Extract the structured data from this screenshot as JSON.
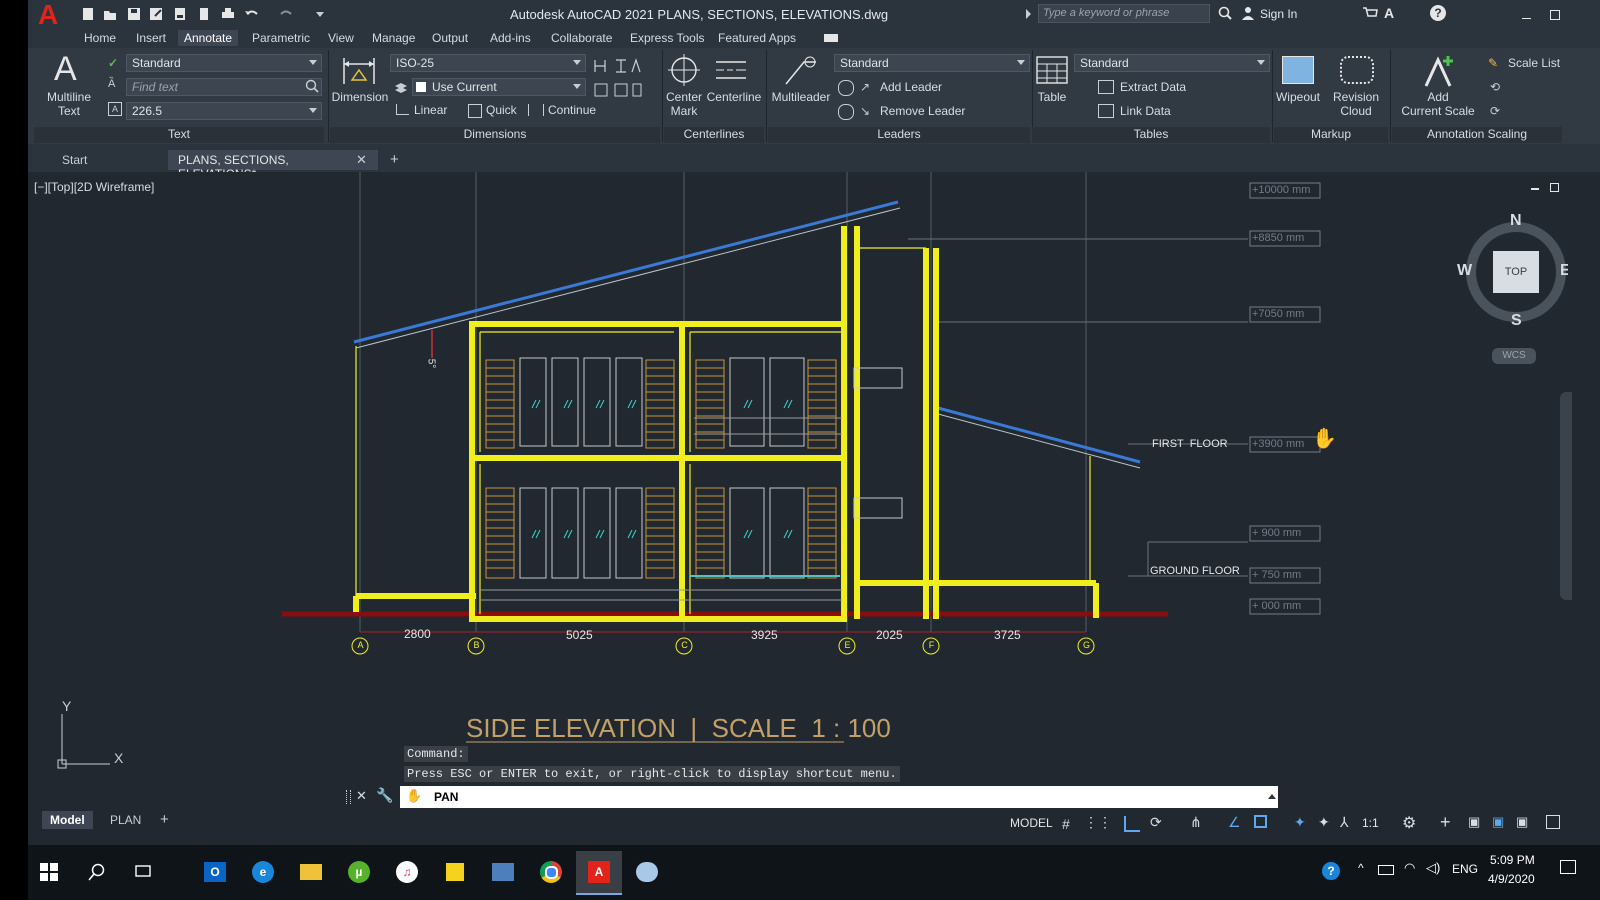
{
  "quick_access": {
    "icons": [
      "new-icon",
      "open-icon",
      "save-icon",
      "save-as-icon",
      "plot-icon",
      "publish-icon",
      "print-icon",
      "undo-icon",
      "redo-icon",
      "dropdown-icon"
    ]
  },
  "window": {
    "title": "Autodesk AutoCAD 2021    PLANS, SECTIONS, ELEVATIONS.dwg",
    "search_placeholder": "Type a keyword or phrase",
    "sign_in": "Sign In"
  },
  "menu_tabs": [
    "Home",
    "Insert",
    "Annotate",
    "Parametric",
    "View",
    "Manage",
    "Output",
    "Add-ins",
    "Collaborate",
    "Express Tools",
    "Featured Apps"
  ],
  "active_tab": "Annotate",
  "ribbon": {
    "text_panel": {
      "title": "Text",
      "big_button": "Multiline\nText",
      "style": "Standard",
      "find_placeholder": "Find text",
      "height": "226.5"
    },
    "dimensions_panel": {
      "title": "Dimensions",
      "big_button": "Dimension",
      "style": "ISO-25",
      "layer": "Use Current",
      "linear": "Linear",
      "quick": "Quick",
      "continue": "Continue"
    },
    "centerlines_panel": {
      "title": "Centerlines",
      "center_mark": "Center\nMark",
      "centerline": "Centerline"
    },
    "leaders_panel": {
      "title": "Leaders",
      "big_button": "Multileader",
      "style": "Standard",
      "add_leader": "Add Leader",
      "remove_leader": "Remove Leader"
    },
    "tables_panel": {
      "title": "Tables",
      "big_button": "Table",
      "style": "Standard",
      "extract": "Extract Data",
      "link": "Link Data"
    },
    "markup_panel": {
      "title": "Markup",
      "wipeout": "Wipeout",
      "revision": "Revision\nCloud"
    },
    "scaling_panel": {
      "title": "Annotation Scaling",
      "add_scale": "Add\nCurrent Scale",
      "scale_list": "Scale List"
    }
  },
  "file_tabs": {
    "start": "Start",
    "active": "PLANS, SECTIONS, ELEVATIONS*"
  },
  "viewport": {
    "label": "[−][Top][2D Wireframe]",
    "viewcube": {
      "n": "N",
      "s": "S",
      "w": "W",
      "e": "E",
      "top": "TOP",
      "wcs": "WCS"
    },
    "levels": [
      "+10000 mm",
      "+8850 mm",
      "+7050 mm",
      "+3900 mm",
      "+ 900 mm",
      "+ 750 mm",
      "+ 000 mm"
    ],
    "floor_labels": {
      "first": "FIRST  FLOOR",
      "ground": "GROUND FLOOR"
    },
    "grid_letters": [
      "A",
      "B",
      "C",
      "E",
      "F",
      "G"
    ],
    "grid_dims": [
      "2800",
      "5025",
      "3925",
      "2025",
      "3725"
    ],
    "slope_label": "5°",
    "drawing_title": "SIDE ELEVATION  |  SCALE  1 : 100",
    "ucs": {
      "x": "X",
      "y": "Y"
    }
  },
  "command": {
    "history": [
      "Command:",
      "Press ESC or ENTER to exit, or right-click to display shortcut menu."
    ],
    "input": "PAN"
  },
  "layout_tabs": [
    "Model",
    "PLAN"
  ],
  "status": {
    "model": "MODEL",
    "scale": "1:1"
  },
  "taskbar": {
    "apps": [
      "outlook-icon",
      "edge-icon",
      "file-explorer-icon",
      "utorrent-icon",
      "itunes-icon",
      "sticky-notes-icon",
      "network-icon",
      "chrome-icon",
      "autocad-icon",
      "paint-icon"
    ],
    "lang": "ENG",
    "time": "5:09 PM",
    "date": "4/9/2020"
  }
}
